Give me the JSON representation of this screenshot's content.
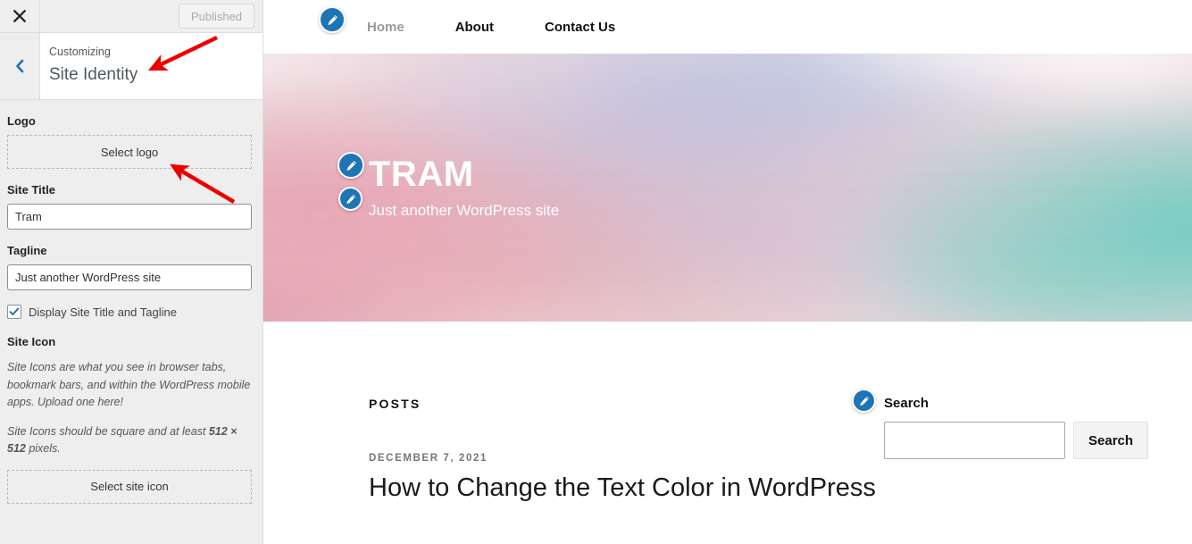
{
  "customizer": {
    "close_icon": "close-icon",
    "publish_label": "Published",
    "back_icon": "chevron-left-icon",
    "eyebrow": "Customizing",
    "panel_title": "Site Identity",
    "logo": {
      "label": "Logo",
      "button_label": "Select logo"
    },
    "site_title": {
      "label": "Site Title",
      "value": "Tram"
    },
    "tagline": {
      "label": "Tagline",
      "value": "Just another WordPress site"
    },
    "display_toggle": {
      "label": "Display Site Title and Tagline",
      "checked": true
    },
    "site_icon": {
      "label": "Site Icon",
      "description_1": "Site Icons are what you see in browser tabs, bookmark bars, and within the WordPress mobile apps. Upload one here!",
      "description_2_pre": "Site Icons should be square and at least ",
      "description_2_bold": "512 × 512",
      "description_2_post": " pixels.",
      "button_label": "Select site icon"
    }
  },
  "preview": {
    "nav": {
      "logo_edit_icon": "pencil-edit-icon",
      "items": [
        {
          "label": "Home",
          "active": false
        },
        {
          "label": "About",
          "active": true
        },
        {
          "label": "Contact Us",
          "active": false
        }
      ]
    },
    "hero": {
      "site_title": "TRAM",
      "tagline": "Just another WordPress site",
      "title_edit_icon": "pencil-edit-icon",
      "tagline_edit_icon": "pencil-edit-icon"
    },
    "content": {
      "posts_heading": "POSTS",
      "post": {
        "date": "DECEMBER 7, 2021",
        "title": "How to Change the Text Color in WordPress"
      }
    },
    "search": {
      "widget_edit_icon": "pencil-edit-icon",
      "label": "Search",
      "input_value": "",
      "placeholder": "",
      "button_label": "Search"
    }
  },
  "annotations": {
    "accent_color": "#ee0000",
    "arrows": [
      {
        "name": "arrow-to-site-identity-title"
      },
      {
        "name": "arrow-to-select-logo"
      }
    ]
  }
}
